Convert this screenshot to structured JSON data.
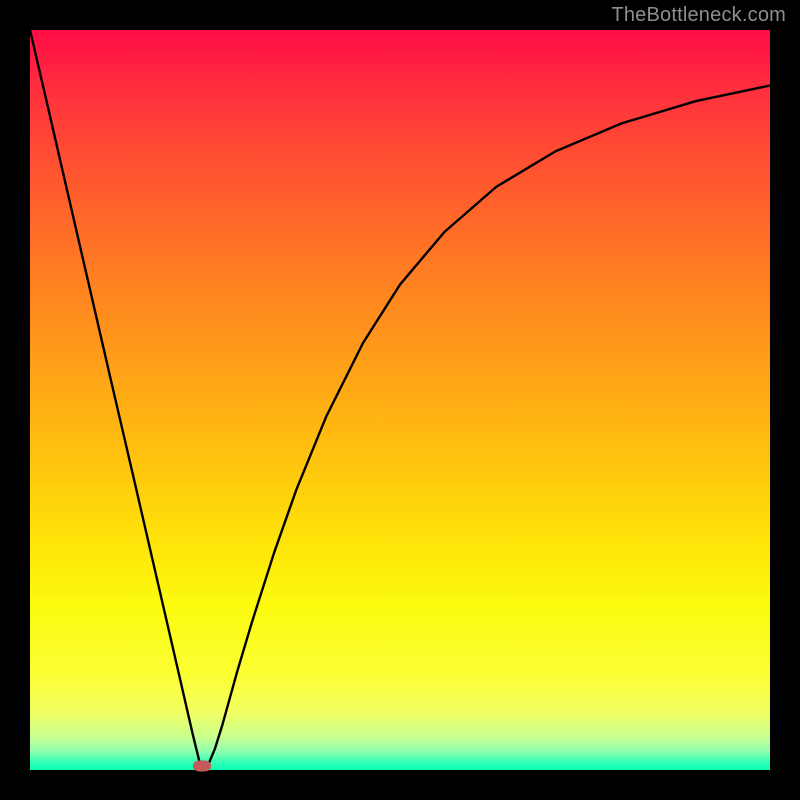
{
  "watermark": "TheBottleneck.com",
  "chart_data": {
    "type": "line",
    "title": "",
    "xlabel": "",
    "ylabel": "",
    "xlim": [
      0,
      100
    ],
    "ylim": [
      0,
      100
    ],
    "x": [
      0,
      2,
      5,
      8,
      11,
      14,
      17,
      20,
      22,
      23,
      24,
      25,
      26,
      28,
      30,
      33,
      36,
      40,
      45,
      50,
      56,
      63,
      71,
      80,
      90,
      100
    ],
    "values": [
      100,
      91.4,
      78.4,
      65.4,
      52.4,
      39.5,
      26.5,
      13.5,
      4.8,
      0.7,
      0.5,
      2.9,
      6.1,
      13.3,
      20.0,
      29.4,
      37.9,
      47.7,
      57.7,
      65.6,
      72.7,
      78.8,
      83.6,
      87.4,
      90.4,
      92.5
    ],
    "marker": {
      "x": 23.3,
      "y": 0.6
    },
    "gradient_stops": [
      {
        "pos": 0.0,
        "color": "#ff0d45"
      },
      {
        "pos": 0.45,
        "color": "#ffb014"
      },
      {
        "pos": 0.78,
        "color": "#fbfb0f"
      },
      {
        "pos": 0.97,
        "color": "#8effb0"
      },
      {
        "pos": 1.0,
        "color": "#0affb5"
      }
    ]
  }
}
